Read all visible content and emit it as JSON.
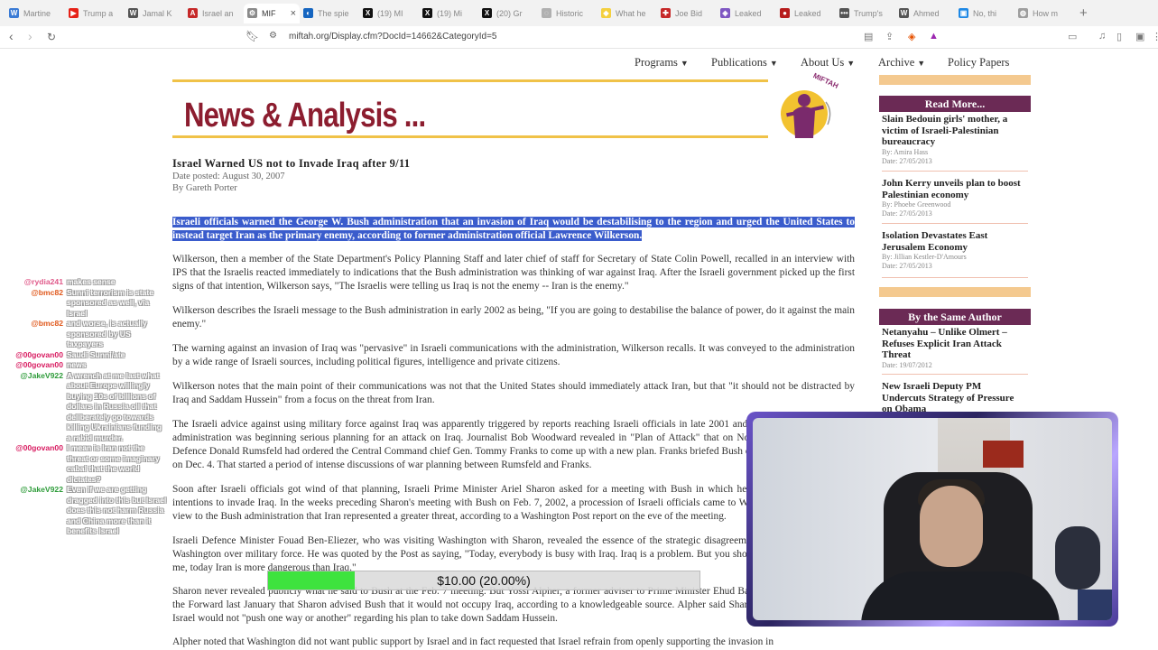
{
  "browser": {
    "tabs": [
      {
        "title": "Martine",
        "color": "#3a7bd5",
        "glyph": "W"
      },
      {
        "title": "Trump a",
        "color": "#e62117",
        "glyph": "▶"
      },
      {
        "title": "Jamal K",
        "color": "#555555",
        "glyph": "W"
      },
      {
        "title": "Israel an",
        "color": "#c62828",
        "glyph": "A"
      },
      {
        "title": "MIF",
        "color": "#8a8a8a",
        "glyph": "⚙",
        "active": true
      },
      {
        "title": "The spie",
        "color": "#1565c0",
        "glyph": "◐"
      },
      {
        "title": "(19) MI",
        "color": "#111111",
        "glyph": "X"
      },
      {
        "title": "(19) Mi",
        "color": "#111111",
        "glyph": "X"
      },
      {
        "title": "(20) Gr",
        "color": "#111111",
        "glyph": "X"
      },
      {
        "title": "Historic",
        "color": "#b0b0b0",
        "glyph": "◌"
      },
      {
        "title": "What he",
        "color": "#f4d03f",
        "glyph": "◆"
      },
      {
        "title": "Joe Bid",
        "color": "#c62828",
        "glyph": "✚"
      },
      {
        "title": "Leaked",
        "color": "#7e57c2",
        "glyph": "◈"
      },
      {
        "title": "Leaked",
        "color": "#b71c1c",
        "glyph": "●"
      },
      {
        "title": "Trump's",
        "color": "#555555",
        "glyph": "•••"
      },
      {
        "title": "Ahmed",
        "color": "#555555",
        "glyph": "W"
      },
      {
        "title": "No, thi",
        "color": "#1e88e5",
        "glyph": "▣"
      },
      {
        "title": "How m",
        "color": "#9e9e9e",
        "glyph": "◍"
      }
    ],
    "url": "miftah.org/Display.cfm?DocId=14662&CategoryId=5"
  },
  "nav": {
    "items": [
      {
        "label": "Programs",
        "caret": true
      },
      {
        "label": "Publications",
        "caret": true
      },
      {
        "label": "About Us",
        "caret": true
      },
      {
        "label": "Archive",
        "caret": true
      },
      {
        "label": "Policy Papers",
        "caret": false
      }
    ]
  },
  "header": {
    "title": "News & Analysis ...",
    "logo_text": "MIFTAH"
  },
  "article": {
    "title": "Israel Warned US not to Invade Iraq after 9/11",
    "date": "Date posted: August 30, 2007",
    "author": "By Gareth Porter",
    "lede": "Israeli officials warned the George W. Bush administration that an invasion of Iraq would be destabilising to the region and urged the United States to instead target Iran as the primary enemy, according to former administration official Lawrence Wilkerson.",
    "paragraphs": [
      "Wilkerson, then a member of the State Department's Policy Planning Staff and later chief of staff for Secretary of State Colin Powell, recalled in an interview with IPS that the Israelis reacted immediately to indications that the Bush administration was thinking of war against Iraq. After the Israeli government picked up the first signs of that intention, Wilkerson says, \"The Israelis were telling us Iraq is not the enemy -- Iran is the enemy.\"",
      "Wilkerson describes the Israeli message to the Bush administration in early 2002 as being, \"If you are going to destabilise the balance of power, do it against the main enemy.\"",
      "The warning against an invasion of Iraq was \"pervasive\" in Israeli communications with the administration, Wilkerson recalls. It was conveyed to the administration by a wide range of Israeli sources, including political figures, intelligence and private citizens.",
      "Wilkerson notes that the main point of their communications was not that the United States should immediately attack Iran, but that \"it should not be distracted by Iraq and Saddam Hussein\" from a focus on the threat from Iran.",
      "The Israeli advice against using military force against Iraq was apparently triggered by reports reaching Israeli officials in late 2001 and early 2002 that the Bush administration was beginning serious planning for an attack on Iraq. Journalist Bob Woodward revealed in \"Plan of Attack\" that on Nov. 21, 2001, Secretary of Defence Donald Rumsfeld had ordered the Central Command chief Gen. Tommy Franks to come up with a new plan. Franks briefed Bush on a new war plan for Iraq on Dec. 4. That started a period of intense discussions of war planning between Rumsfeld and Franks.",
      "Soon after Israeli officials got wind of that planning, Israeli Prime Minister Ariel Sharon asked for a meeting with Bush in which he expressed concern about intentions to invade Iraq. In the weeks preceding Sharon's meeting with Bush on Feb. 7, 2002, a procession of Israeli officials came to Washington to express their view to the Bush administration that Iran represented a greater threat, according to a Washington Post report on the eve of the meeting.",
      "Israeli Defence Minister Fouad Ben-Eliezer, who was visiting Washington with Sharon, revealed the essence of the strategic disagreement between Tel Aviv and Washington over military force. He was quoted by the Post as saying, \"Today, everybody is busy with Iraq. Iraq is a problem. But you should understand, if you ask me, today Iran is more dangerous than Iraq.\"",
      "Sharon never revealed publicly what he said to Bush at the Feb. 7 meeting. But Yossi Alpher, a former adviser to Prime Minister Ehud Barak, wrote in an article in the Forward last January that Sharon advised Bush that it would not occupy Iraq, according to a knowledgeable source. Alpher said Sharon also assured Bush that Israel would not \"push one way or another\" regarding his plan to take down Saddam Hussein.",
      "Alpher noted that Washington did not want public support by Israel and in fact requested that Israel refrain from openly supporting the invasion in"
    ]
  },
  "sidebar": {
    "read_more_label": "Read More...",
    "read_more": [
      {
        "title": "Slain Bedouin girls' mother, a victim of Israeli-Palestinian bureaucracy",
        "by": "By: Amira Hass",
        "date": "Date: 27/05/2013"
      },
      {
        "title": "John Kerry unveils plan to boost Palestinian economy",
        "by": "By: Phoebe Greenwood",
        "date": "Date: 27/05/2013"
      },
      {
        "title": "Isolation Devastates East Jerusalem Economy",
        "by": "By: Jillian Kestler-D'Amours",
        "date": "Date: 27/05/2013"
      }
    ],
    "same_author_label": "By the Same Author",
    "same_author": [
      {
        "title": "Netanyahu – Unlike Olmert – Refuses Explicit Iran Attack Threat",
        "date": "Date: 19/07/2012"
      },
      {
        "title": "New Israeli Deputy PM Undercuts Strategy of Pressure on Obama",
        "date": ""
      }
    ]
  },
  "stream": {
    "chat": [
      {
        "user": "@rydia241",
        "color": "#e05a8a",
        "text": "makes sense"
      },
      {
        "user": "@bmc82",
        "color": "#e05a1e",
        "text": "Sunni terrorism is state sponsored as well, via Israel"
      },
      {
        "user": "@bmc82",
        "color": "#e05a1e",
        "text": "and worse, is actually sponsored by US taxpayers"
      },
      {
        "user": "@00govan00",
        "color": "#d81b60",
        "text": "Saudi Sunni/ate"
      },
      {
        "user": "@00govan00",
        "color": "#d81b60",
        "text": "news"
      },
      {
        "user": "@JakeV922",
        "color": "#2e9c3a",
        "text": "A wrench at me last what about Europe willingly buying 10s of billions of dollars in Russia oil that deliberately go towards killing Ukrainians funding a rabid murder."
      },
      {
        "user": "@00govan00",
        "color": "#d81b60",
        "text": "I mean is Iran not the threat or some imaginary cabal that the world dictates?"
      },
      {
        "user": "@JakeV922",
        "color": "#2e9c3a",
        "text": "Even if we are getting dragged into this but Israel does this not harm Russia and China more than it benefits Israel"
      }
    ],
    "donation": {
      "label": "$10.00 (20.00%)",
      "progress": 0.2,
      "fill_color": "#3ee33e"
    }
  }
}
